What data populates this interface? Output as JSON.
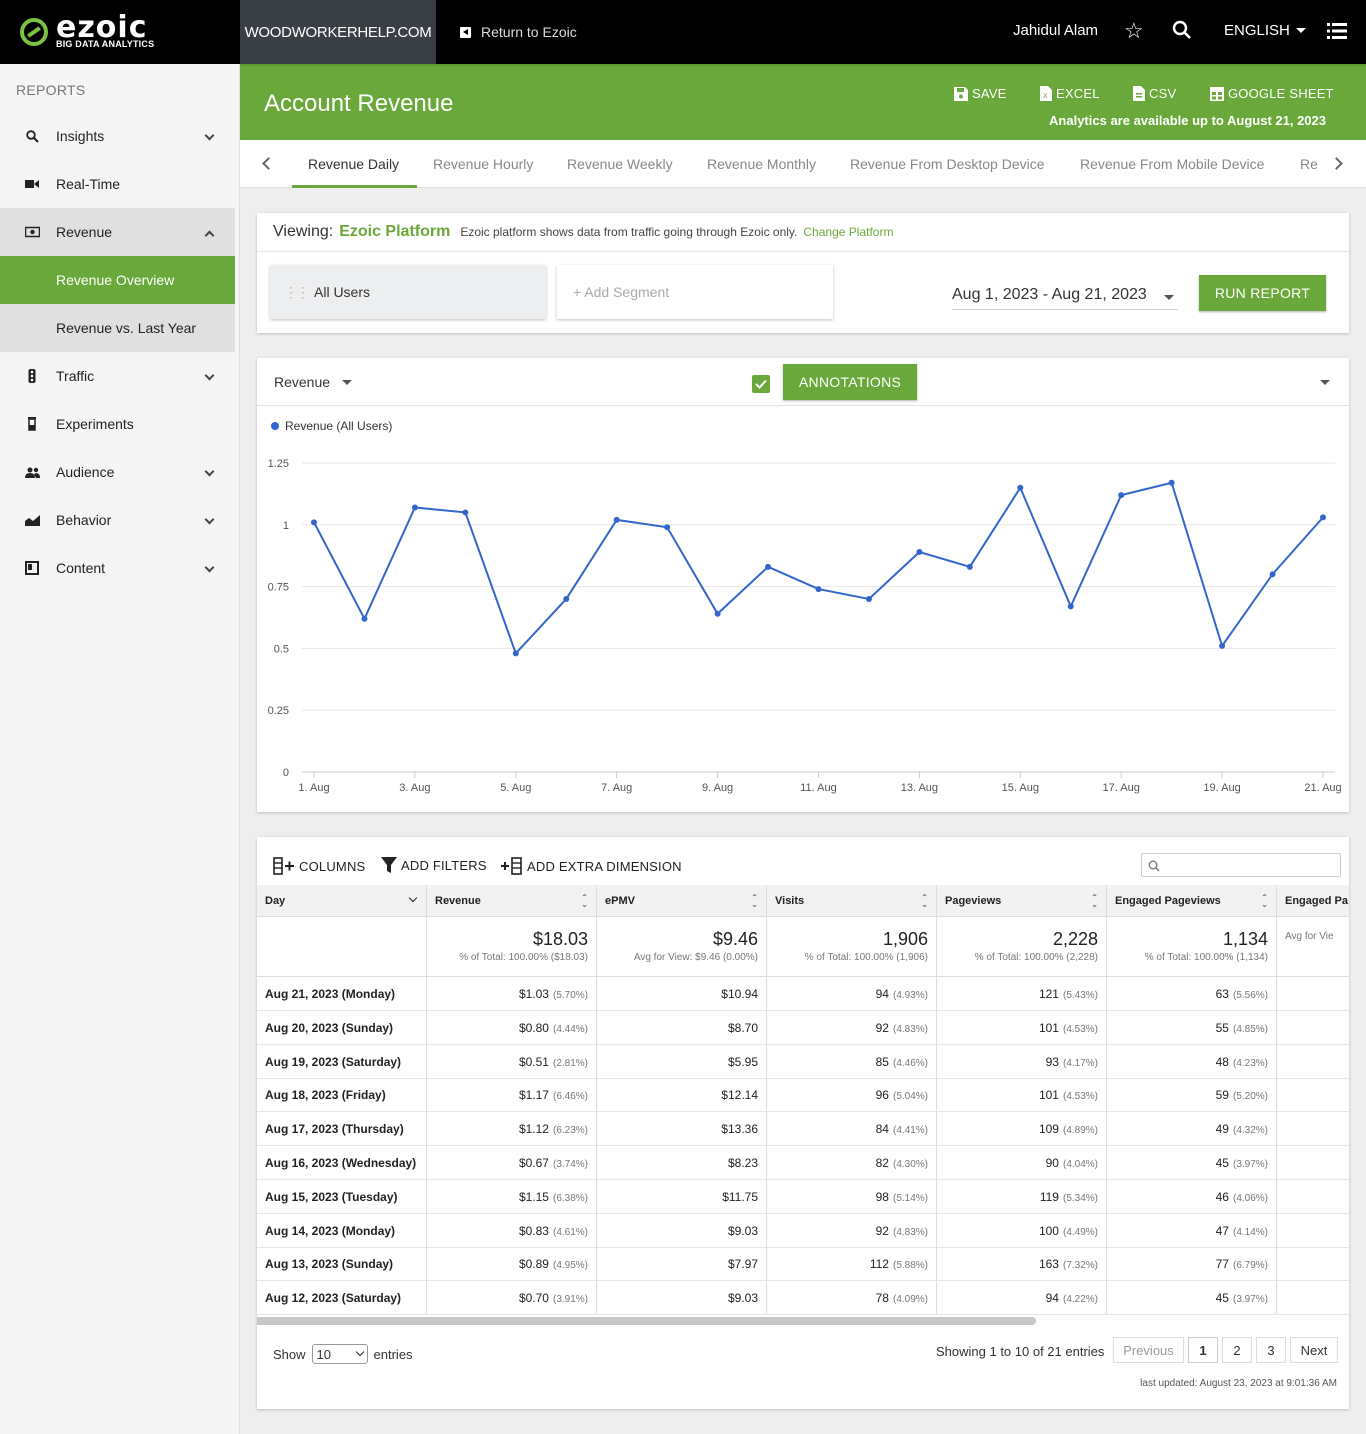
{
  "brand": {
    "name": "ezoic",
    "tagline": "BIG DATA ANALYTICS"
  },
  "topbar": {
    "site": "WOODWORKERHELP.COM",
    "return_label": "Return to Ezoic",
    "user": "Jahidul Alam",
    "language": "ENGLISH"
  },
  "sidebar": {
    "heading": "REPORTS",
    "items": [
      {
        "label": "Insights",
        "icon": "search-icon"
      },
      {
        "label": "Real-Time",
        "icon": "video-icon"
      },
      {
        "label": "Revenue",
        "icon": "money-icon"
      },
      {
        "label": "Revenue Overview"
      },
      {
        "label": "Revenue vs. Last Year"
      },
      {
        "label": "Traffic",
        "icon": "traffic-light-icon"
      },
      {
        "label": "Experiments",
        "icon": "flask-icon"
      },
      {
        "label": "Audience",
        "icon": "people-icon"
      },
      {
        "label": "Behavior",
        "icon": "area-chart-icon"
      },
      {
        "label": "Content",
        "icon": "book-icon"
      }
    ]
  },
  "header": {
    "title": "Account Revenue",
    "save": "SAVE",
    "excel": "EXCEL",
    "csv": "CSV",
    "gsheet": "GOOGLE SHEET",
    "note": "Analytics are available up to August 21, 2023"
  },
  "tabs": [
    "Revenue Daily",
    "Revenue Hourly",
    "Revenue Weekly",
    "Revenue Monthly",
    "Revenue From Desktop Device",
    "Revenue From Mobile Device",
    "Re"
  ],
  "viewing": {
    "label": "Viewing:",
    "platform": "Ezoic Platform",
    "desc": "Ezoic platform shows data from traffic going through Ezoic only.",
    "change": "Change Platform"
  },
  "segments": {
    "current": "All Users",
    "add": "+ Add Segment"
  },
  "date_range": "Aug 1, 2023 - Aug 21, 2023",
  "run_report": "RUN REPORT",
  "chart_toolbar": {
    "metric": "Revenue",
    "annotations": "ANNOTATIONS"
  },
  "chart_data": {
    "type": "line",
    "series": [
      {
        "name": "Revenue (All Users)",
        "color": "#3366cc",
        "values": [
          1.01,
          0.62,
          1.07,
          1.05,
          0.48,
          0.7,
          1.02,
          0.99,
          0.64,
          0.83,
          0.74,
          0.7,
          0.89,
          0.83,
          1.15,
          0.67,
          1.12,
          1.17,
          0.51,
          0.8,
          1.03
        ]
      }
    ],
    "x": [
      "1. Aug",
      "2. Aug",
      "3. Aug",
      "4. Aug",
      "5. Aug",
      "6. Aug",
      "7. Aug",
      "8. Aug",
      "9. Aug",
      "10. Aug",
      "11. Aug",
      "12. Aug",
      "13. Aug",
      "14. Aug",
      "15. Aug",
      "16. Aug",
      "17. Aug",
      "18. Aug",
      "19. Aug",
      "20. Aug",
      "21. Aug"
    ],
    "xtick_labels": [
      "1. Aug",
      "3. Aug",
      "5. Aug",
      "7. Aug",
      "9. Aug",
      "11. Aug",
      "13. Aug",
      "15. Aug",
      "17. Aug",
      "19. Aug",
      "21. Aug"
    ],
    "yticks": [
      "0",
      "0.25",
      "0.5",
      "0.75",
      "1",
      "1.25"
    ],
    "ylim": [
      0,
      1.25
    ],
    "legend": "top-left",
    "grid": true
  },
  "table_toolbar": {
    "columns": "COLUMNS",
    "filters": "ADD FILTERS",
    "dimension": "ADD EXTRA DIMENSION"
  },
  "table": {
    "headers": [
      "Day",
      "Revenue",
      "ePMV",
      "Visits",
      "Pageviews",
      "Engaged Pageviews",
      "Engaged Pa"
    ],
    "totals": [
      {
        "v": "",
        "s": ""
      },
      {
        "v": "$18.03",
        "s": "% of Total: 100.00% ($18.03)"
      },
      {
        "v": "$9.46",
        "s": "Avg for View: $9.46 (0.00%)"
      },
      {
        "v": "1,906",
        "s": "% of Total: 100.00% (1,906)"
      },
      {
        "v": "2,228",
        "s": "% of Total: 100.00% (2,228)"
      },
      {
        "v": "1,134",
        "s": "% of Total: 100.00% (1,134)"
      },
      {
        "v": "",
        "s": "Avg for Vie"
      }
    ],
    "rows": [
      [
        "Aug 21, 2023 (Monday)",
        "$1.03",
        "(5.70%)",
        "$10.94",
        "94",
        "(4.93%)",
        "121",
        "(5.43%)",
        "63",
        "(5.56%)"
      ],
      [
        "Aug 20, 2023 (Sunday)",
        "$0.80",
        "(4.44%)",
        "$8.70",
        "92",
        "(4.83%)",
        "101",
        "(4.53%)",
        "55",
        "(4.85%)"
      ],
      [
        "Aug 19, 2023 (Saturday)",
        "$0.51",
        "(2.81%)",
        "$5.95",
        "85",
        "(4.46%)",
        "93",
        "(4.17%)",
        "48",
        "(4.23%)"
      ],
      [
        "Aug 18, 2023 (Friday)",
        "$1.17",
        "(6.46%)",
        "$12.14",
        "96",
        "(5.04%)",
        "101",
        "(4.53%)",
        "59",
        "(5.20%)"
      ],
      [
        "Aug 17, 2023 (Thursday)",
        "$1.12",
        "(6.23%)",
        "$13.36",
        "84",
        "(4.41%)",
        "109",
        "(4.89%)",
        "49",
        "(4.32%)"
      ],
      [
        "Aug 16, 2023 (Wednesday)",
        "$0.67",
        "(3.74%)",
        "$8.23",
        "82",
        "(4.30%)",
        "90",
        "(4.04%)",
        "45",
        "(3.97%)"
      ],
      [
        "Aug 15, 2023 (Tuesday)",
        "$1.15",
        "(6.38%)",
        "$11.75",
        "98",
        "(5.14%)",
        "119",
        "(5.34%)",
        "46",
        "(4.06%)"
      ],
      [
        "Aug 14, 2023 (Monday)",
        "$0.83",
        "(4.61%)",
        "$9.03",
        "92",
        "(4.83%)",
        "100",
        "(4.49%)",
        "47",
        "(4.14%)"
      ],
      [
        "Aug 13, 2023 (Sunday)",
        "$0.89",
        "(4.95%)",
        "$7.97",
        "112",
        "(5.88%)",
        "163",
        "(7.32%)",
        "77",
        "(6.79%)"
      ],
      [
        "Aug 12, 2023 (Saturday)",
        "$0.70",
        "(3.91%)",
        "$9.03",
        "78",
        "(4.09%)",
        "94",
        "(4.22%)",
        "45",
        "(3.97%)"
      ]
    ]
  },
  "pagination": {
    "show": "Show",
    "entries_value": "10",
    "entries": "entries",
    "info": "Showing 1 to 10 of 21 entries",
    "prev": "Previous",
    "pages": [
      "1",
      "2",
      "3"
    ],
    "next": "Next",
    "updated": "last updated: August 23, 2023 at 9:01:36 AM"
  }
}
